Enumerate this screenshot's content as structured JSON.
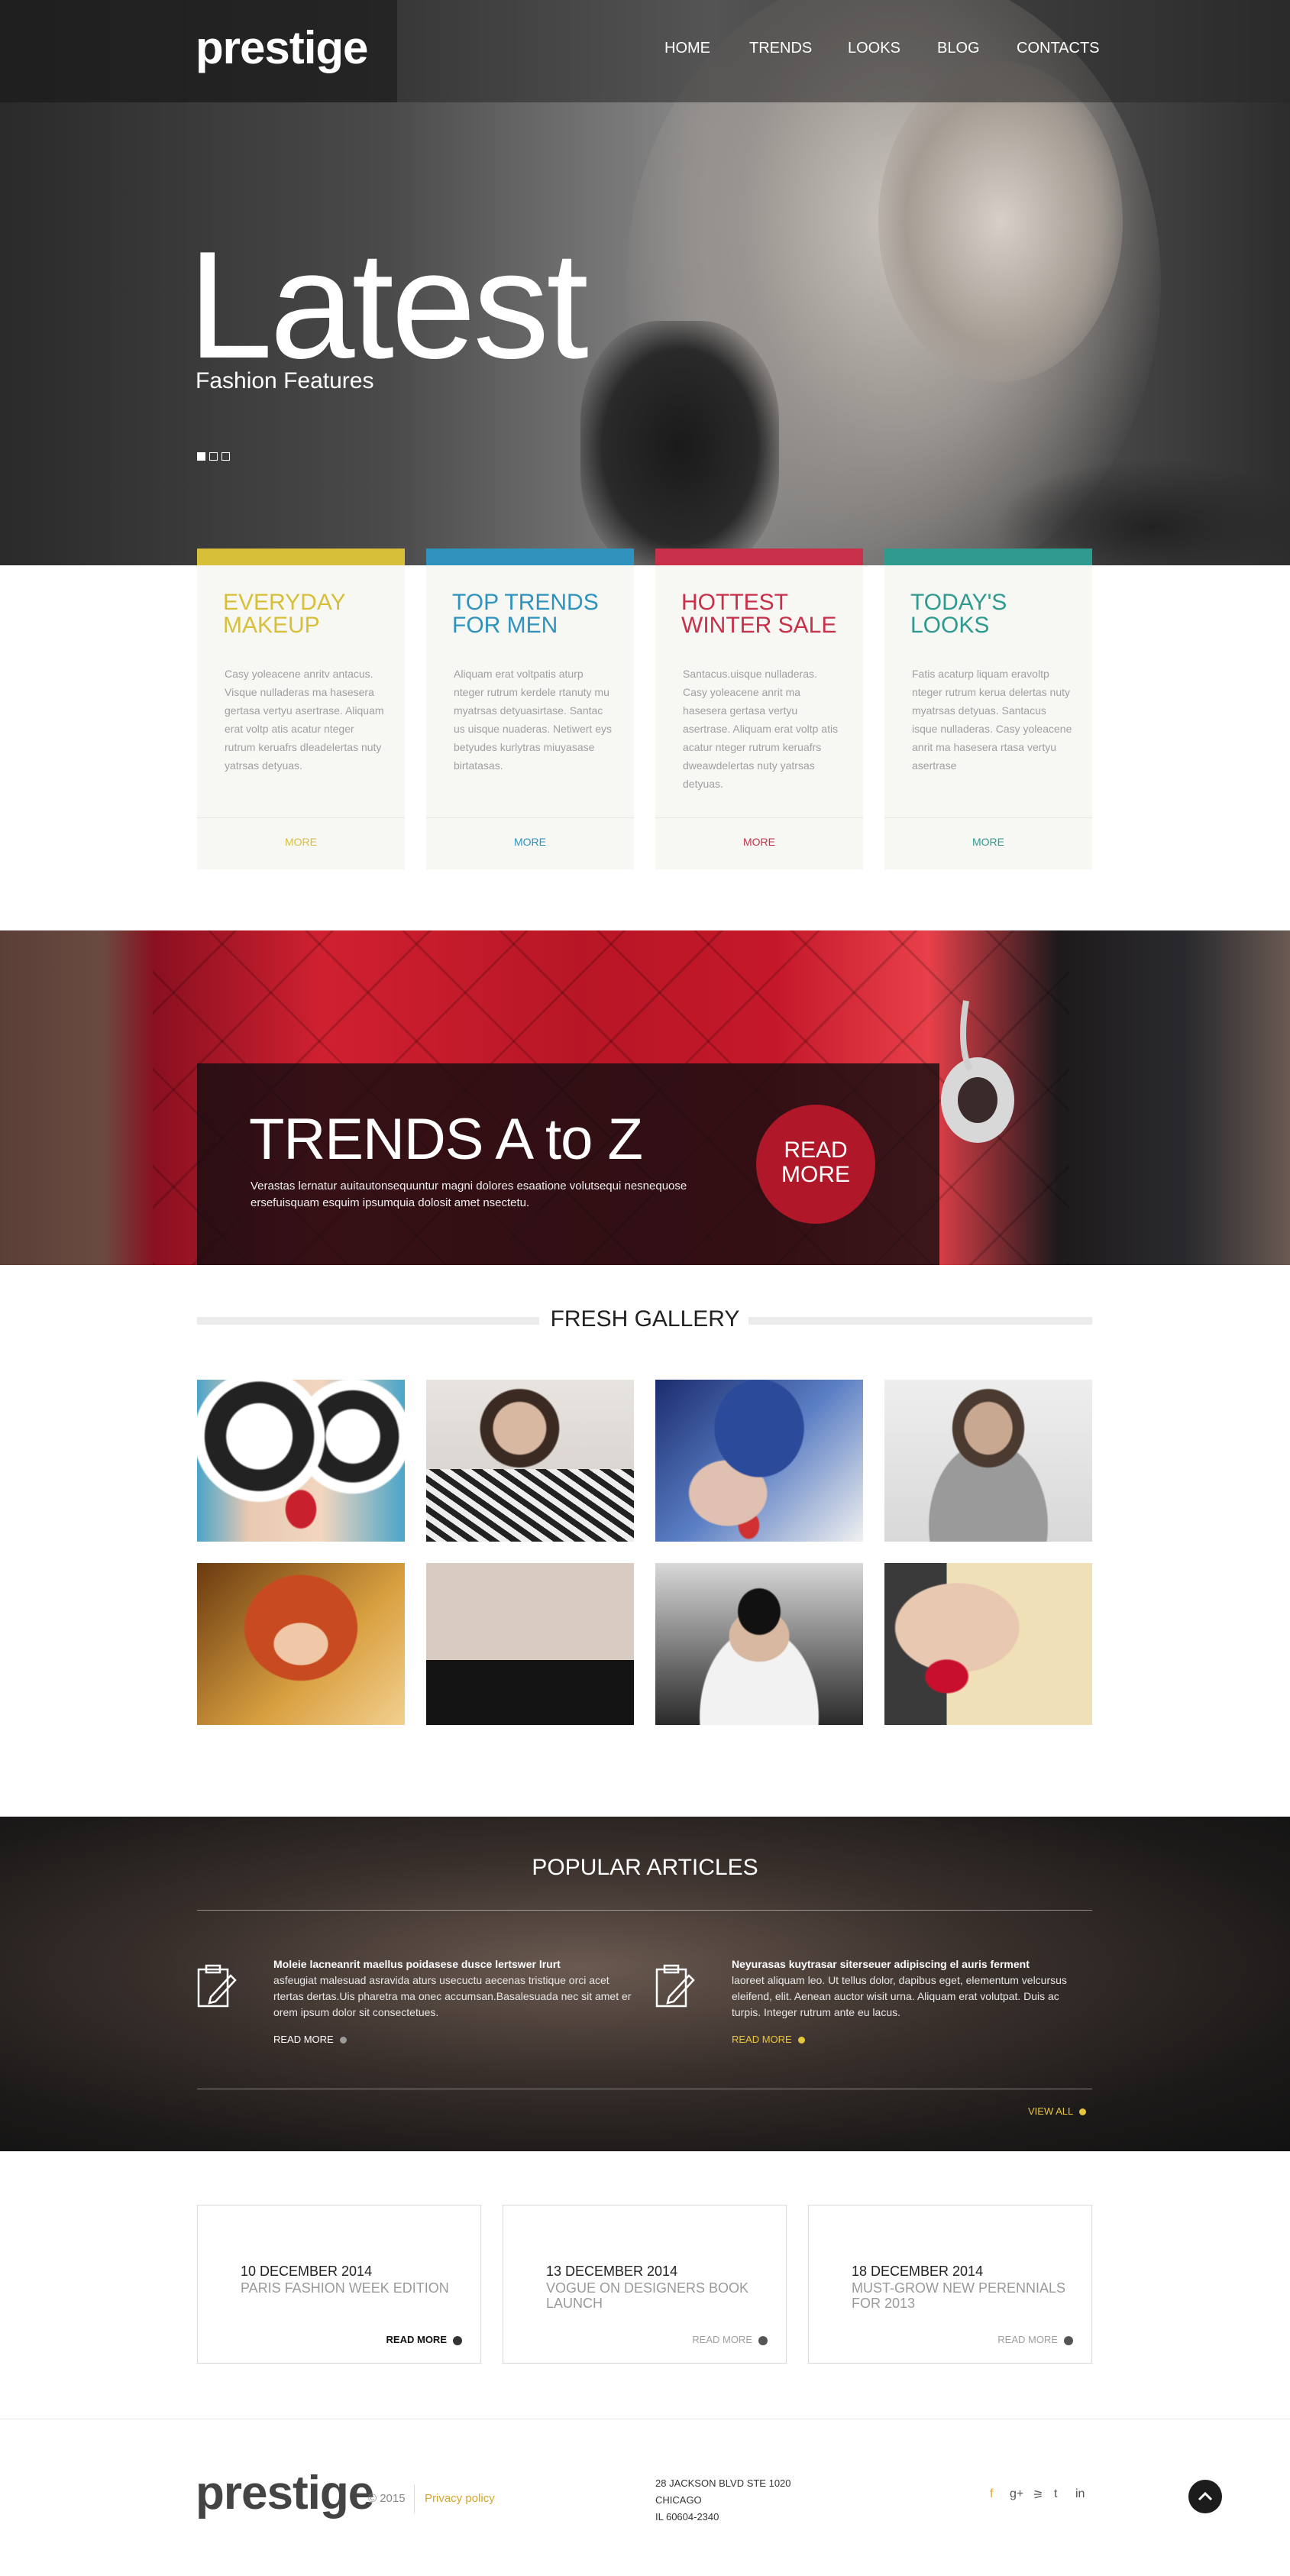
{
  "header": {
    "logo": "prestige",
    "nav": [
      "HOME",
      "TRENDS",
      "LOOKS",
      "BLOG",
      "CONTACTS"
    ]
  },
  "hero": {
    "title": "Latest",
    "subtitle": "Fashion Features",
    "slides_total": 3,
    "slide_active": 1
  },
  "cards": [
    {
      "title": "EVERYDAY MAKEUP",
      "color": "#d8bf3a",
      "text": "Casy yoleacene anritv antacus. Visque nulladeras ma hasesera gertasa vertyu asertrase. Aliquam erat voltp atis acatur nteger rutrum keruafrs dleadelertas nuty yatrsas detyuas.",
      "more": "MORE"
    },
    {
      "title": "TOP TRENDS FOR MEN",
      "color": "#2f93bd",
      "text": "Aliquam erat voltpatis aturp nteger rutrum kerdele rtanuty mu myatrsas detyuasirtase. Santac us uisque nuaderas. Netiwert eys betyudes kurlytras miuyasase birtatasas.",
      "more": "MORE"
    },
    {
      "title": "HOTTEST WINTER SALE",
      "color": "#c8304a",
      "text": "Santacus.uisque nulladeras. Casy yoleacene anrit ma hasesera gertasa vertyu asertrase. Aliquam erat voltp atis acatur nteger rutrum keruafrs dweawdelertas nuty yatrsas detyuas.",
      "more": "MORE"
    },
    {
      "title": "TODAY'S LOOKS",
      "color": "#2f9a8e",
      "text": "Fatis acaturp liquam eravoltp nteger rutrum kerua delertas nuty myatrsas detyuas. Santacus isque nulladeras. Casy yoleacene anrit ma hasesera rtasa vertyu asertrase",
      "more": "MORE"
    }
  ],
  "banner": {
    "title": "TRENDS A to Z",
    "text": "Verastas lernatur auitautonsequuntur magni dolores esaatione volutsequi nesnequose ersefuisquam esquim ipsumquia dolosit amet nsectetu.",
    "button": "READ MORE"
  },
  "gallery": {
    "title": "FRESH GALLERY",
    "items": [
      "photo-woman-sunglasses",
      "photo-man-scarf",
      "photo-woman-feathers",
      "photo-man-grey-shirt",
      "photo-woman-red-hair",
      "photo-woman-veil",
      "photo-man-sunglasses",
      "photo-woman-red-lips"
    ]
  },
  "popular": {
    "title": "POPULAR ARTICLES",
    "articles": [
      {
        "title": "Moleie lacneanrit maellus poidasese dusce lertswer lrurt",
        "text": "asfeugiat malesuad asravida aturs usecuctu aecenas tristique orci acet rtertas dertas.Uis pharetra ma onec accumsan.Basalesuada nec sit amet er orem ipsum dolor sit consectetues.",
        "more": "READ MORE",
        "accent": "#ffffff"
      },
      {
        "title": "Neyurasas kuytrasar siterseuer adipiscing el auris ferment",
        "text": "laoreet aliquam leo. Ut tellus dolor, dapibus eget, elementum velcursus eleifend, elit. Aenean auctor wisit urna. Aliquam erat volutpat. Duis ac turpis. Integer rutrum ante eu lacus.",
        "more": "READ MORE",
        "accent": "#e7c53d"
      }
    ],
    "view_all": "VIEW ALL"
  },
  "news": [
    {
      "date": "10 DECEMBER 2014",
      "title": "PARIS FASHION WEEK EDITION",
      "more": "READ MORE",
      "emphasis": true
    },
    {
      "date": "13 DECEMBER 2014",
      "title": "VOGUE ON DESIGNERS BOOK LAUNCH",
      "more": "READ MORE",
      "emphasis": false
    },
    {
      "date": "18 DECEMBER 2014",
      "title": "MUST-GROW NEW PERENNIALS FOR 2013",
      "more": "READ MORE",
      "emphasis": false
    }
  ],
  "footer": {
    "logo": "prestige",
    "copyright": "© 2015",
    "privacy": "Privacy policy",
    "address": [
      "28 JACKSON BLVD STE 1020",
      "CHICAGO",
      "IL 60604-2340"
    ],
    "social": [
      {
        "name": "facebook-icon",
        "glyph": "f",
        "color": "#e0a63a"
      },
      {
        "name": "google-plus-icon",
        "glyph": "g+",
        "color": "#555555"
      },
      {
        "name": "rss-icon",
        "glyph": "⚞",
        "color": "#555555"
      },
      {
        "name": "twitter-icon",
        "glyph": "t",
        "color": "#555555"
      },
      {
        "name": "linkedin-icon",
        "glyph": "in",
        "color": "#555555"
      }
    ]
  }
}
